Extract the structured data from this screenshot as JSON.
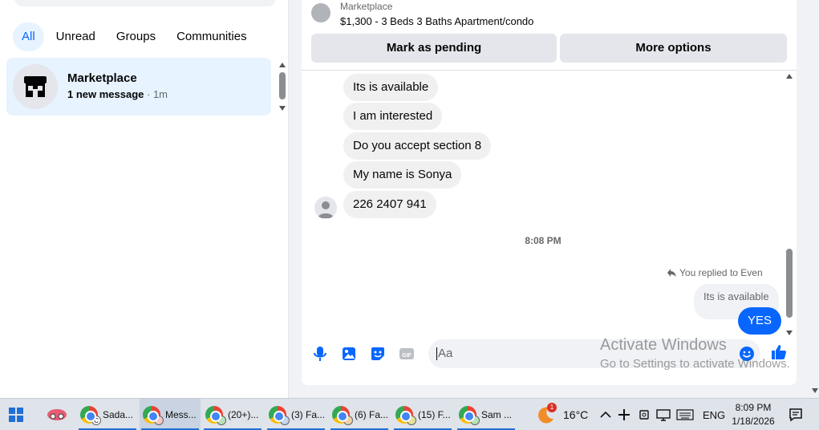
{
  "left_panel": {
    "filters": [
      "All",
      "Unread",
      "Groups",
      "Communities"
    ],
    "active_filter": "All",
    "chat": {
      "title": "Marketplace",
      "message": "1 new message",
      "separator": " · ",
      "time": "1m"
    }
  },
  "conversation": {
    "header": {
      "label": "Marketplace",
      "listing": "$1,300 - 3 Beds 3 Baths Apartment/condo",
      "mark_pending": "Mark as pending",
      "more_options": "More options"
    },
    "incoming_messages": [
      "Its is available",
      "I am interested",
      "Do you accept section 8",
      "My name is Sonya",
      "226 2407 941"
    ],
    "timestamp": "8:08 PM",
    "reply_note": "You replied to Even",
    "quoted_message": "Its is available",
    "outgoing_message": "YES",
    "composer_placeholder": "Aa"
  },
  "watermark": {
    "line1": "Activate Windows",
    "line2": "Go to Settings to activate Windows."
  },
  "taskbar": {
    "apps": [
      {
        "label": "Sada...",
        "badge": "C"
      },
      {
        "label": "Mess...",
        "badge": ""
      },
      {
        "label": "(20+)...",
        "badge": ""
      },
      {
        "label": "(3) Fa...",
        "badge": ""
      },
      {
        "label": "(6) Fa...",
        "badge": ""
      },
      {
        "label": "(15) F...",
        "badge": ""
      },
      {
        "label": "Sam ...",
        "badge": ""
      }
    ],
    "weather_badge": "1",
    "temperature": "16°C",
    "language": "ENG",
    "time": "8:09 PM",
    "date": "1/18/2026"
  },
  "colors": {
    "accent": "#0866ff",
    "selected_bg": "#e7f3ff",
    "bubble_bg": "#f0f0f0"
  }
}
